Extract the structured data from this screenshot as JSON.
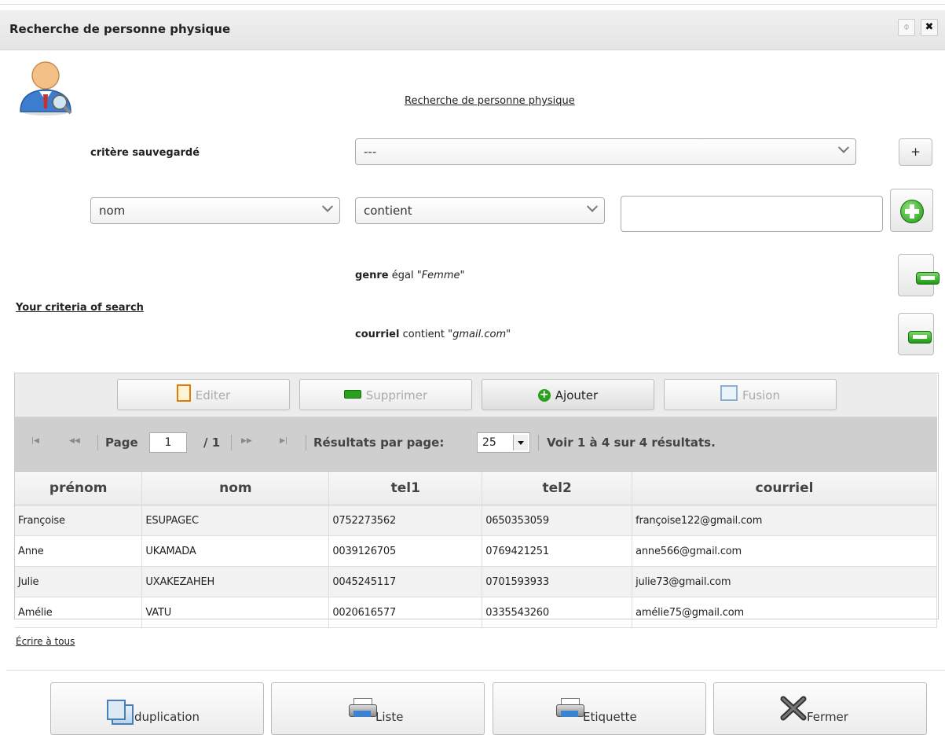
{
  "dialog": {
    "title": "Recherche de personne physique",
    "pin_label": "⌽",
    "close_label": "✖"
  },
  "search": {
    "heading": "Recherche de personne physique",
    "saved_label": "critère sauvegardé",
    "saved_value": "---",
    "add_saved_label": "+",
    "field_value": "nom",
    "operator_value": "contient",
    "value_input": ""
  },
  "criteria": {
    "title": "Your criteria of search",
    "items": [
      {
        "field": "genre",
        "op": "égal",
        "value": "\"Femme\""
      },
      {
        "field": "courriel",
        "op": "contient",
        "value": "\"gmail.com\""
      }
    ]
  },
  "toolbar": {
    "edit": "Editer",
    "delete": "Supprimer",
    "add": "Ajouter",
    "merge": "Fusion"
  },
  "pager": {
    "page_label": "Page",
    "page_value": "1",
    "page_total": "/ 1",
    "per_page_label": "Résultats par page:",
    "per_page_value": "25",
    "summary": "Voir 1 à 4 sur 4 résultats."
  },
  "grid": {
    "columns": [
      "prénom",
      "nom",
      "tel1",
      "tel2",
      "courriel"
    ],
    "rows": [
      [
        "Françoise",
        "ESUPAGEC",
        "0752273562",
        "0650353059",
        "françoise122@gmail.com"
      ],
      [
        "Anne",
        "UKAMADA",
        "0039126705",
        "0769421251",
        "anne566@gmail.com"
      ],
      [
        "Julie",
        "UXAKEZAHEH",
        "0045245117",
        "0701593933",
        "julie73@gmail.com"
      ],
      [
        "Amélie",
        "VATU",
        "0020616577",
        "0335543260",
        "amélie75@gmail.com"
      ]
    ]
  },
  "write_all": "Écrire à tous",
  "footer": {
    "duplicate": "duplication",
    "list": "Liste",
    "label": "Etiquette",
    "close": "Fermer"
  }
}
